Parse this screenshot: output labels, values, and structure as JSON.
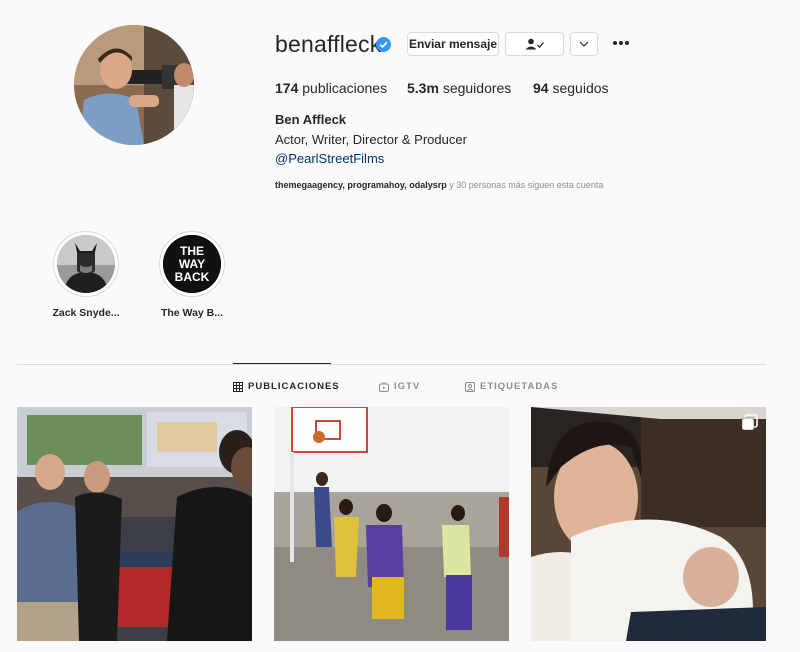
{
  "profile": {
    "username": "benaffleck",
    "full_name": "Ben Affleck",
    "bio": "Actor, Writer, Director & Producer",
    "link": "@PearlStreetFilms",
    "stats": {
      "posts_count": "174",
      "posts_label": "publicaciones",
      "followers_count": "5.3m",
      "followers_label": "seguidores",
      "following_count": "94",
      "following_label": "seguidos"
    },
    "followed_by_names": "themegaagency, programahoy, odalysrp",
    "followed_by_rest": "y 30 personas más siguen esta cuenta"
  },
  "actions": {
    "message_label": "Enviar mensaje"
  },
  "highlights": [
    {
      "label": "Zack Snyde..."
    },
    {
      "label": "The Way B...",
      "logo_lines": [
        "THE",
        "WAY",
        "BACK"
      ]
    }
  ],
  "tabs": [
    {
      "label": "PUBLICACIONES",
      "icon": "grid-icon",
      "active": true
    },
    {
      "label": "IGTV",
      "icon": "igtv-icon",
      "active": false
    },
    {
      "label": "ETIQUETADAS",
      "icon": "tagged-icon",
      "active": false
    }
  ],
  "colors": {
    "verified": "#3897f0",
    "link": "#00376b",
    "background": "#fafafa"
  }
}
